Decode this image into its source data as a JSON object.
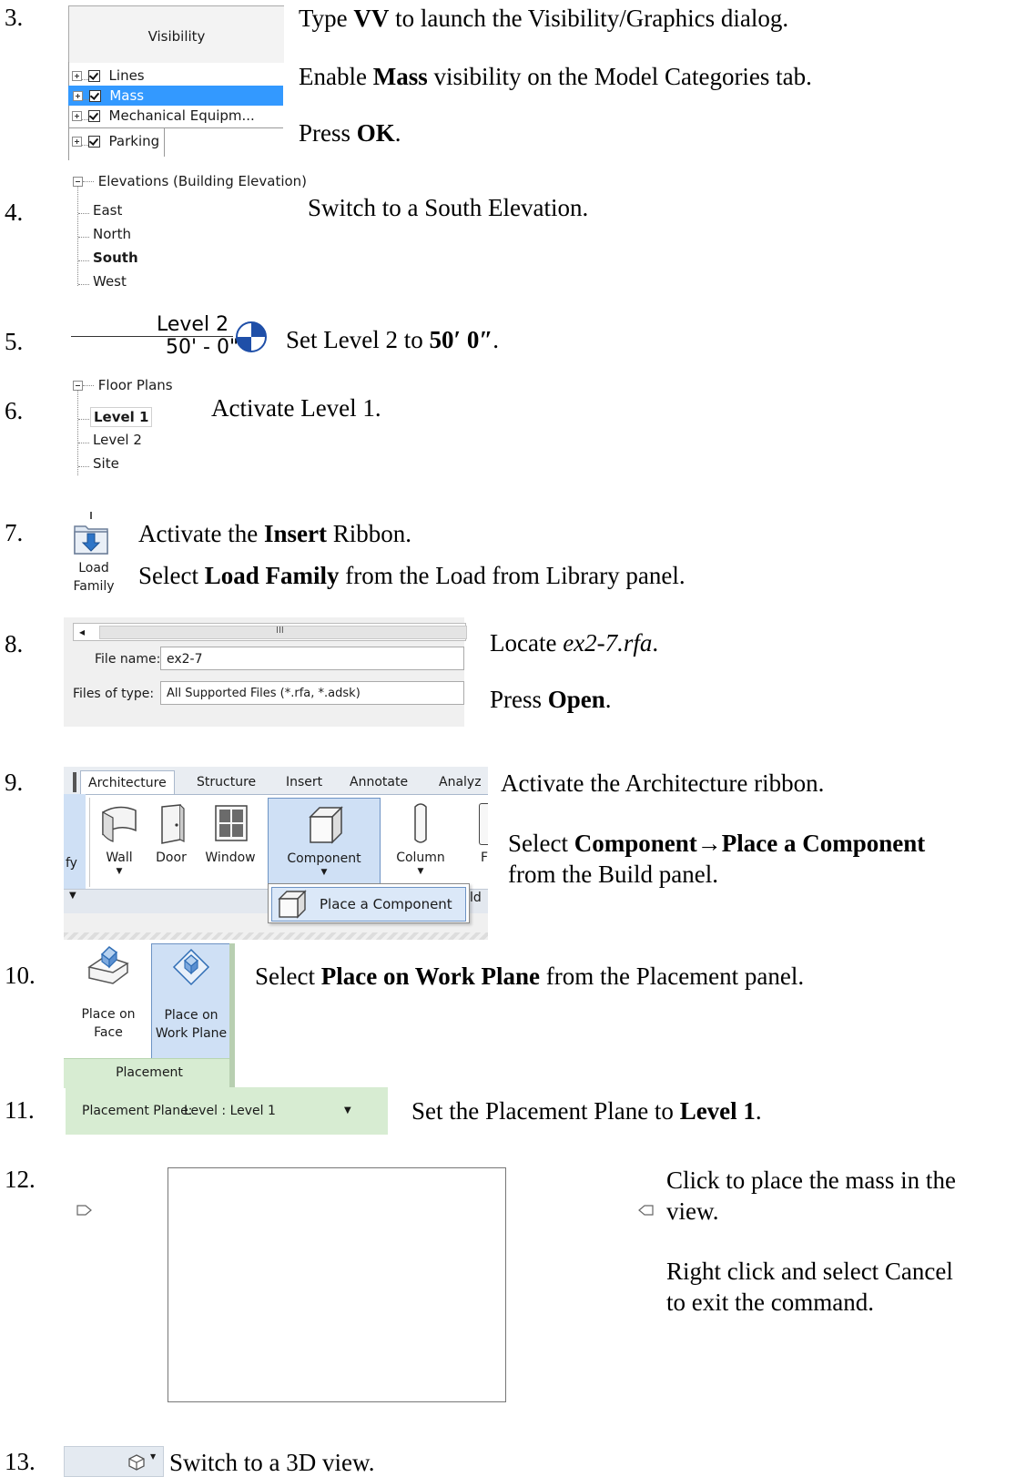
{
  "colors": {
    "selection": "#3399ff",
    "ribbon_active": "#cfe0f5",
    "panel_green": "#d7ecd2",
    "level_marker": "#1f4fa8"
  },
  "steps": [
    {
      "num": "3.",
      "lines": [
        {
          "pre": "Type ",
          "bold": "VV",
          "post": " to launch the Visibility/Graphics dialog."
        },
        {
          "pre": "Enable ",
          "bold": "Mass",
          "post": " visibility on the Model Categories tab."
        },
        {
          "pre": "Press ",
          "bold": "OK",
          "post": "."
        }
      ]
    },
    {
      "num": "4.",
      "lines": [
        {
          "pre": "Switch to a South Elevation.",
          "bold": "",
          "post": ""
        }
      ]
    },
    {
      "num": "5.",
      "lines": [
        {
          "pre": "Set Level 2 to ",
          "bold": "50′ 0″",
          "post": "."
        }
      ]
    },
    {
      "num": "6.",
      "lines": [
        {
          "pre": "Activate Level 1.",
          "bold": "",
          "post": ""
        }
      ]
    },
    {
      "num": "7.",
      "lines": [
        {
          "pre": "Activate the ",
          "bold": "Insert",
          "post": " Ribbon."
        },
        {
          "pre": "Select ",
          "bold": "Load Family",
          "post": " from the Load from Library panel."
        }
      ]
    },
    {
      "num": "8.",
      "lines": [
        {
          "pre": "Locate ",
          "italic": "ex2-7.rfa",
          "post": "."
        },
        {
          "pre": "Press ",
          "bold": "Open",
          "post": "."
        }
      ]
    },
    {
      "num": "9.",
      "lines": [
        {
          "pre": "Activate the Architecture ribbon.",
          "bold": "",
          "post": ""
        },
        {
          "pre": "Select ",
          "bold": "Component→Place a Component",
          "post": ""
        },
        {
          "pre": "from the Build panel.",
          "bold": "",
          "post": ""
        }
      ]
    },
    {
      "num": "10.",
      "lines": [
        {
          "pre": "Select ",
          "bold": "Place on Work Plane",
          "post": " from the Placement panel."
        }
      ]
    },
    {
      "num": "11.",
      "lines": [
        {
          "pre": "Set the Placement Plane to ",
          "bold": "Level 1",
          "post": "."
        }
      ]
    },
    {
      "num": "12.",
      "lines": [
        {
          "pre": "Click to place the mass in the",
          "bold": "",
          "post": ""
        },
        {
          "pre": "view.",
          "bold": "",
          "post": ""
        },
        {
          "pre": "Right click and select Cancel",
          "bold": "",
          "post": ""
        },
        {
          "pre": "to exit the command.",
          "bold": "",
          "post": ""
        }
      ]
    },
    {
      "num": "13.",
      "lines": [
        {
          "pre": "Switch to a 3D view.",
          "bold": "",
          "post": ""
        }
      ]
    }
  ],
  "vis_dialog": {
    "header": "Visibility",
    "rows": [
      "Lines",
      "Mass",
      "Mechanical Equipm...",
      "Parking"
    ]
  },
  "elev_tree": {
    "root": "Elevations (Building Elevation)",
    "items": [
      "East",
      "North",
      "South",
      "West"
    ],
    "selected": "South"
  },
  "level_marker": {
    "name": "Level 2",
    "value": "50' - 0\""
  },
  "floor_tree": {
    "root": "Floor Plans",
    "items": [
      "Level 1",
      "Level 2",
      "Site"
    ],
    "selected": "Level 1"
  },
  "load_family": {
    "line1": "Load",
    "line2": "Family"
  },
  "open_dialog": {
    "scroll_mark": "III",
    "filename_label": "File name:",
    "filename_value": "ex2-7",
    "filetype_label": "Files of type:",
    "filetype_value": "All Supported Files  (*.rfa, *.adsk)"
  },
  "ribbon": {
    "tabs": [
      "Architecture",
      "Structure",
      "Insert",
      "Annotate",
      "Analyz"
    ],
    "tools": [
      "Wall",
      "Door",
      "Window",
      "Component",
      "Column"
    ],
    "left_cut": "fy",
    "right_cut": "F",
    "panel_cut": "ld",
    "dropdown_item": "Place a Component"
  },
  "placement_panel": {
    "face_line1": "Place on",
    "face_line2": "Face",
    "plane_line1": "Place on",
    "plane_line2": "Work Plane",
    "panel_label": "Placement"
  },
  "placement_plane": {
    "label": "Placement Plane:",
    "value": "Level : Level 1"
  }
}
